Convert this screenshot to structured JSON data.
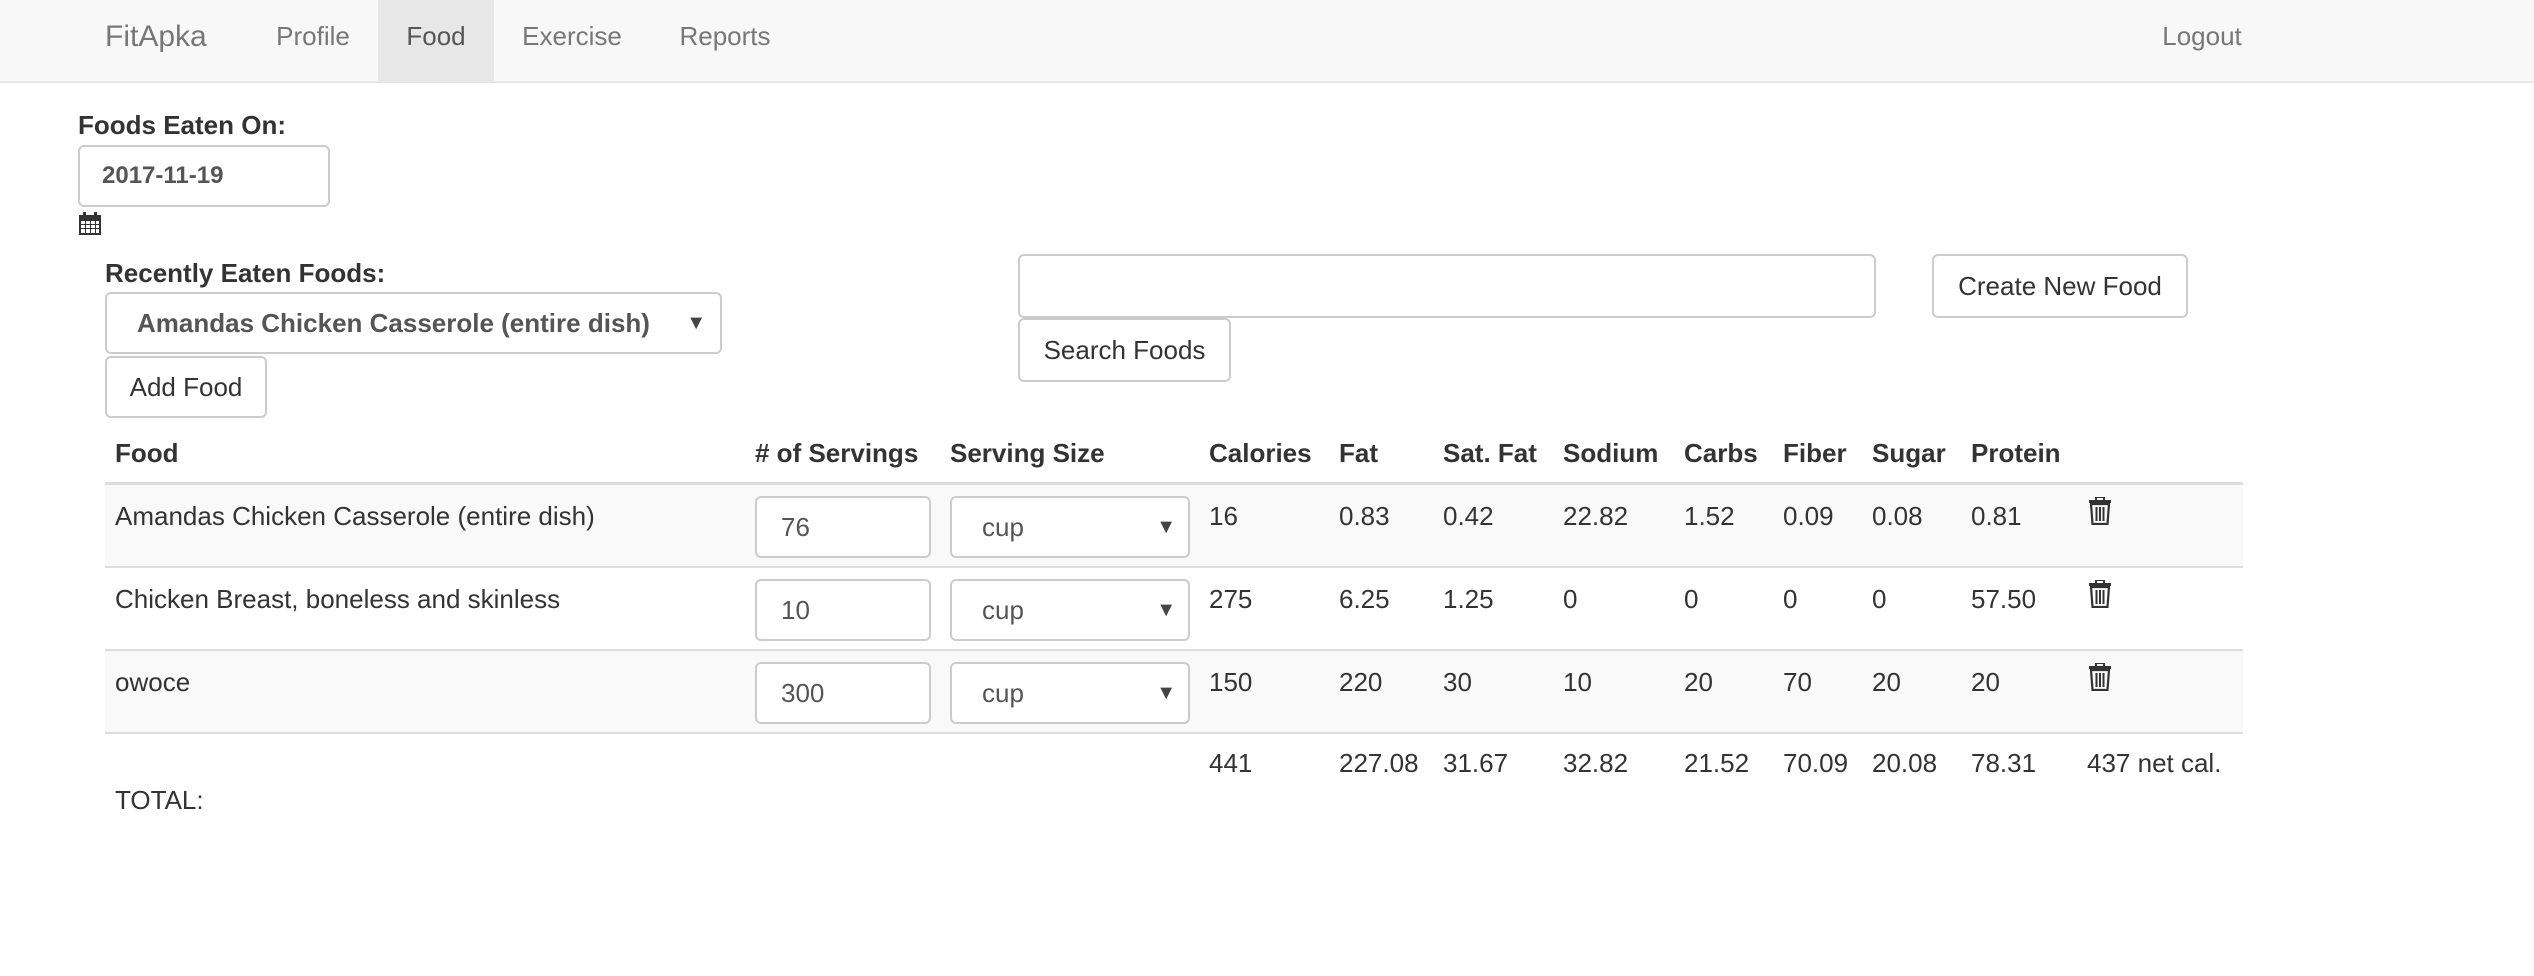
{
  "nav": {
    "brand": "FitApka",
    "links": [
      "Profile",
      "Food",
      "Exercise",
      "Reports"
    ],
    "active": "Food",
    "logout": "Logout"
  },
  "date_section": {
    "label": "Foods Eaten On:",
    "date_value": "2017-11-19",
    "calendar_icon": "calendar-icon"
  },
  "recent": {
    "label": "Recently Eaten Foods:",
    "selected": "Amandas Chicken Casserole (entire dish)",
    "add_button": "Add Food"
  },
  "search": {
    "query": "",
    "search_button": "Search Foods",
    "create_button": "Create New Food"
  },
  "table": {
    "headers": [
      "Food",
      "# of Servings",
      "Serving Size",
      "Calories",
      "Fat",
      "Sat. Fat",
      "Sodium",
      "Carbs",
      "Fiber",
      "Sugar",
      "Protein"
    ],
    "rows": [
      {
        "food": "Amandas Chicken Casserole (entire dish)",
        "servings": "76",
        "size": "cup",
        "calories": "16",
        "fat": "0.83",
        "sat_fat": "0.42",
        "sodium": "22.82",
        "carbs": "1.52",
        "fiber": "0.09",
        "sugar": "0.08",
        "protein": "0.81"
      },
      {
        "food": "Chicken Breast, boneless and skinless",
        "servings": "10",
        "size": "cup",
        "calories": "275",
        "fat": "6.25",
        "sat_fat": "1.25",
        "sodium": "0",
        "carbs": "0",
        "fiber": "0",
        "sugar": "0",
        "protein": "57.50"
      },
      {
        "food": "owoce",
        "servings": "300",
        "size": "cup",
        "calories": "150",
        "fat": "220",
        "sat_fat": "30",
        "sodium": "10",
        "carbs": "20",
        "fiber": "70",
        "sugar": "20",
        "protein": "20"
      }
    ],
    "totals": {
      "label": "TOTAL:",
      "calories": "441",
      "fat": "227.08",
      "sat_fat": "31.67",
      "sodium": "32.82",
      "carbs": "21.52",
      "fiber": "70.09",
      "sugar": "20.08",
      "protein": "78.31",
      "net": "437 net cal."
    },
    "delete_icon": "trash-icon"
  }
}
